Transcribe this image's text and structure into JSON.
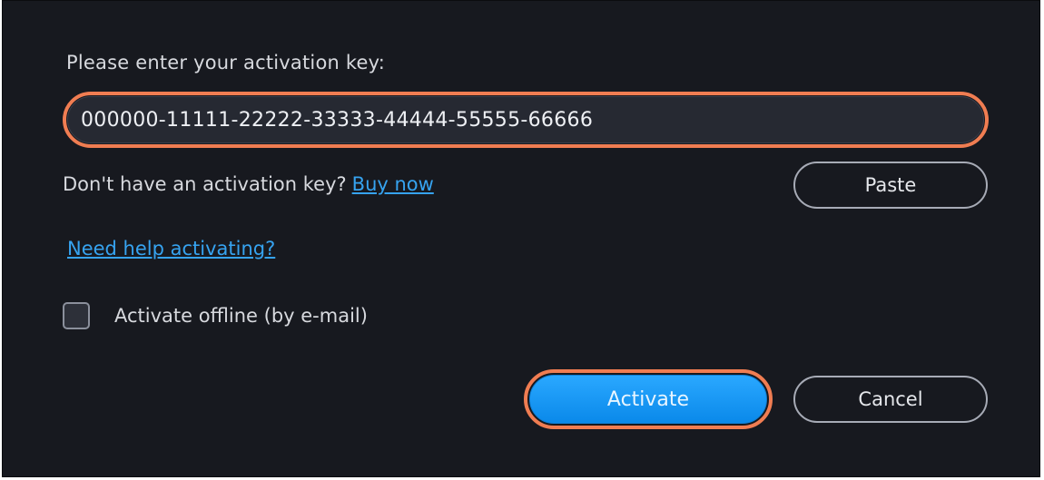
{
  "dialog": {
    "prompt": "Please enter your activation key:",
    "key_value": "000000-11111-22222-33333-44444-55555-66666",
    "no_key_text": "Don't have an activation key?",
    "buy_now_label": "Buy now",
    "paste_label": "Paste",
    "help_link_label": "Need help activating?",
    "offline_label": "Activate offline (by e-mail)",
    "offline_checked": false,
    "activate_label": "Activate",
    "cancel_label": "Cancel"
  },
  "colors": {
    "background": "#17191f",
    "highlight": "#f07d52",
    "link": "#36a3f0",
    "primary_button": "#1a98f5"
  }
}
